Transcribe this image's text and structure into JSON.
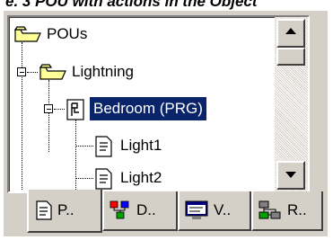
{
  "caption": "e. 3 POU with actions in the Object",
  "tree": {
    "items": [
      {
        "label": "POUs",
        "icon": "folder-icon"
      },
      {
        "label": "Lightning",
        "icon": "folder-icon"
      },
      {
        "label": "Bedroom (PRG)",
        "icon": "program-icon",
        "selected": true
      },
      {
        "label": "Light1",
        "icon": "action-document-icon"
      },
      {
        "label": "Light2",
        "icon": "action-document-icon"
      }
    ]
  },
  "tabs": [
    {
      "label": "P..",
      "icon": "document-icon",
      "active": true
    },
    {
      "label": "D..",
      "icon": "data-types-icon"
    },
    {
      "label": "V..",
      "icon": "visualization-icon"
    },
    {
      "label": "R..",
      "icon": "resources-icon"
    }
  ],
  "colors": {
    "selection": "#0a246a",
    "face": "#d4d0c8",
    "folder": "#ffff99"
  }
}
